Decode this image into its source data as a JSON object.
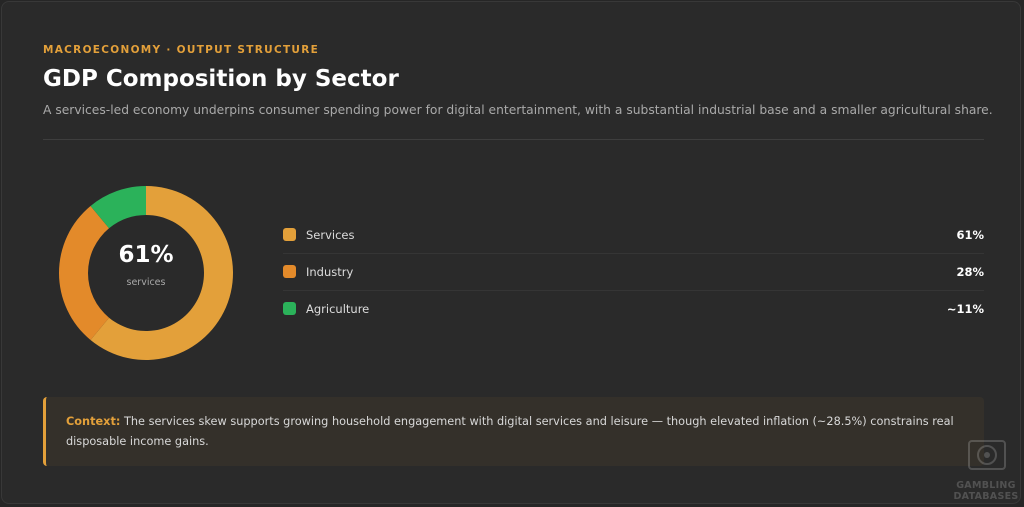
{
  "header": {
    "eyebrow": "MACROECONOMY · OUTPUT STRUCTURE",
    "title": "GDP Composition by Sector",
    "subtitle": "A services-led economy underpins consumer spending power for digital entertainment, with a substantial industrial base and a smaller agricultural share."
  },
  "donut": {
    "center_value": "61%",
    "center_label": "services"
  },
  "chart_data": {
    "type": "pie",
    "categories": [
      "Services",
      "Industry",
      "Agriculture"
    ],
    "values": [
      61,
      28,
      11
    ],
    "value_labels": [
      "61%",
      "28%",
      "~11%"
    ],
    "colors": [
      "#e3a03a",
      "#e38a2a",
      "#2bb25a"
    ],
    "legend_position": "right"
  },
  "legend": [
    {
      "name": "Services",
      "value": "61%",
      "color": "#e3a03a"
    },
    {
      "name": "Industry",
      "value": "28%",
      "color": "#e38a2a"
    },
    {
      "name": "Agriculture",
      "value": "~11%",
      "color": "#2bb25a"
    }
  ],
  "context": {
    "label": "Context:",
    "text": " The services skew supports growing household engagement with digital services and leisure — though elevated inflation (~28.5%) constrains real disposable income gains."
  },
  "watermark": {
    "line1": "GAMBLING",
    "line2": "DATABASES"
  },
  "colors": {
    "accent": "#e3a03a",
    "background": "#2a2a2a"
  }
}
